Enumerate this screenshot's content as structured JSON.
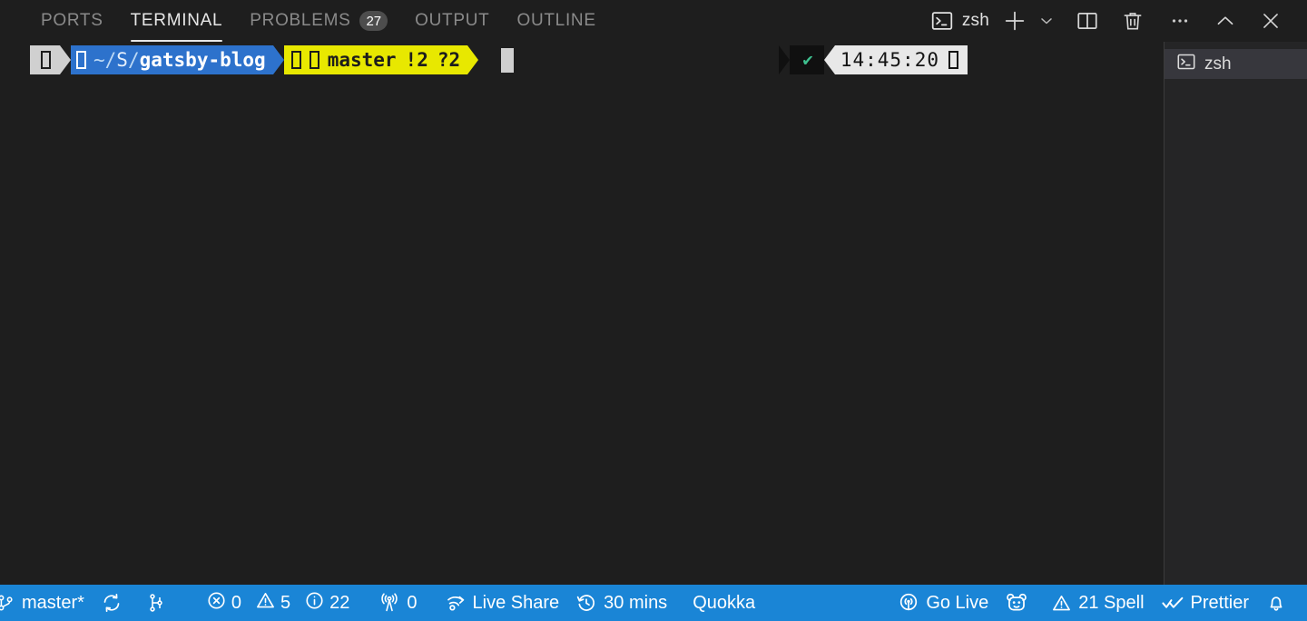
{
  "panel": {
    "tabs": [
      {
        "label": "PORTS",
        "active": false,
        "badge": null
      },
      {
        "label": "TERMINAL",
        "active": true,
        "badge": null
      },
      {
        "label": "PROBLEMS",
        "active": false,
        "badge": "27"
      },
      {
        "label": "OUTPUT",
        "active": false,
        "badge": null
      },
      {
        "label": "OUTLINE",
        "active": false,
        "badge": null
      }
    ],
    "actions": {
      "shell_label": "zsh",
      "shell_icon": "terminal-icon",
      "new_terminal_icon": "plus-icon",
      "new_terminal_dropdown_icon": "chevron-down-icon",
      "split_terminal_icon": "split-editor-icon",
      "kill_terminal_icon": "trash-icon",
      "views_and_more_icon": "ellipsis-icon",
      "maximize_panel_icon": "chevron-up-icon",
      "close_panel_icon": "close-icon"
    }
  },
  "terminal": {
    "prompt": {
      "user_segment_glyph": "tofu-box",
      "path_folder_glyph": "tofu-box",
      "path_prefix": "~/",
      "path_mid": "S",
      "path_sep": "/",
      "path_dir": "gatsby-blog",
      "git_glyph_1": "tofu-box",
      "git_glyph_2": "tofu-box",
      "git_branch": "master",
      "git_staged": "!2",
      "git_untracked": "?2",
      "status_ok_glyph": "✔",
      "time": "14:45:20",
      "time_glyph": "tofu-box"
    },
    "cursor": "block-cursor"
  },
  "terminal_tabs": [
    {
      "label": "zsh",
      "icon": "terminal-icon",
      "selected": true
    }
  ],
  "status_bar": {
    "left": [
      {
        "name": "remote-branch",
        "icon": "source-control-icon",
        "label": "master*"
      },
      {
        "name": "sync-changes",
        "icon": "sync-icon",
        "label": ""
      },
      {
        "name": "git-graph",
        "icon": "git-graph-icon",
        "label": ""
      },
      {
        "name": "errors",
        "icon": "error-icon",
        "label": "0"
      },
      {
        "name": "warnings",
        "icon": "warning-icon",
        "label": "5"
      },
      {
        "name": "infos",
        "icon": "info-icon",
        "label": "22"
      },
      {
        "name": "ports",
        "icon": "radio-tower-icon",
        "label": "0"
      },
      {
        "name": "live-share",
        "icon": "broadcast-icon",
        "label": "Live Share"
      },
      {
        "name": "wakatime",
        "icon": "history-icon",
        "label": "30 mins"
      },
      {
        "name": "quokka",
        "icon": null,
        "label": "Quokka"
      }
    ],
    "right": [
      {
        "name": "go-live",
        "icon": "broadcast-icon",
        "label": "Go Live"
      },
      {
        "name": "quokka-face",
        "icon": "quokka-face-icon",
        "label": ""
      },
      {
        "name": "spell-checker",
        "icon": "warning-icon",
        "label": "21 Spell"
      },
      {
        "name": "prettier",
        "icon": "double-check-icon",
        "label": "Prettier"
      },
      {
        "name": "notifications",
        "icon": "bell-icon",
        "label": ""
      }
    ]
  },
  "colors": {
    "terminal_bg": "#1e1e1e",
    "status_bar_bg": "#1a85d6",
    "prompt_path_bg": "#2d72cc",
    "prompt_git_bg": "#e8e800",
    "prompt_user_bg": "#d0d0d0",
    "prompt_ok_fg": "#3ec08f",
    "tab_badge_bg": "#4d4d4d",
    "tab_list_bg": "#252526",
    "tab_selected_bg": "#37373d"
  }
}
